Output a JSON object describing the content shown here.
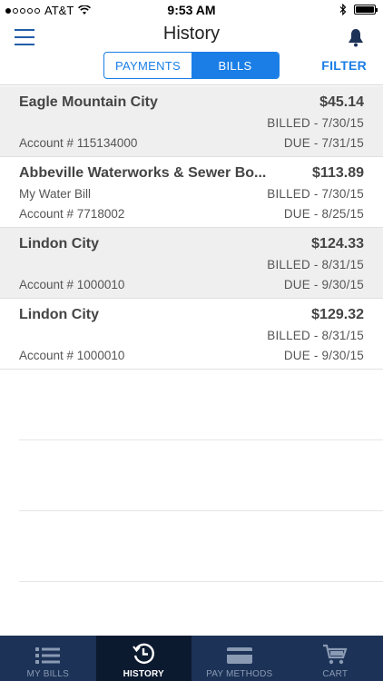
{
  "status_bar": {
    "carrier": "AT&T",
    "time": "9:53 AM",
    "signal_bars_filled": 1,
    "signal_bars_total": 5
  },
  "header": {
    "title": "History",
    "segments": [
      {
        "label": "PAYMENTS",
        "active": false
      },
      {
        "label": "BILLS",
        "active": true
      }
    ],
    "filter_label": "FILTER"
  },
  "bills": [
    {
      "name": "Eagle Mountain City",
      "amount": "$45.14",
      "sub": "",
      "billed": "BILLED - 7/30/15",
      "account": "Account # 115134000",
      "due": "DUE - 7/31/15",
      "shaded": true
    },
    {
      "name": "Abbeville Waterworks & Sewer Bo...",
      "amount": "$113.89",
      "sub": "My Water Bill",
      "billed": "BILLED - 7/30/15",
      "account": "Account # 7718002",
      "due": "DUE - 8/25/15",
      "shaded": false
    },
    {
      "name": "Lindon City",
      "amount": "$124.33",
      "sub": "",
      "billed": "BILLED - 8/31/15",
      "account": "Account # 1000010",
      "due": "DUE - 9/30/15",
      "shaded": true
    },
    {
      "name": "Lindon City",
      "amount": "$129.32",
      "sub": "",
      "billed": "BILLED - 8/31/15",
      "account": "Account # 1000010",
      "due": "DUE - 9/30/15",
      "shaded": false
    }
  ],
  "tabbar": [
    {
      "label": "MY BILLS",
      "icon": "list-icon",
      "active": false
    },
    {
      "label": "HISTORY",
      "icon": "history-clock-icon",
      "active": true
    },
    {
      "label": "PAY METHODS",
      "icon": "credit-card-icon",
      "active": false
    },
    {
      "label": "CART",
      "icon": "cart-icon",
      "active": false
    }
  ],
  "colors": {
    "accent": "#1a7ee6",
    "tabbar_bg": "#1c3257",
    "tabbar_active": "#0c1a30",
    "row_shaded": "#efefef"
  }
}
